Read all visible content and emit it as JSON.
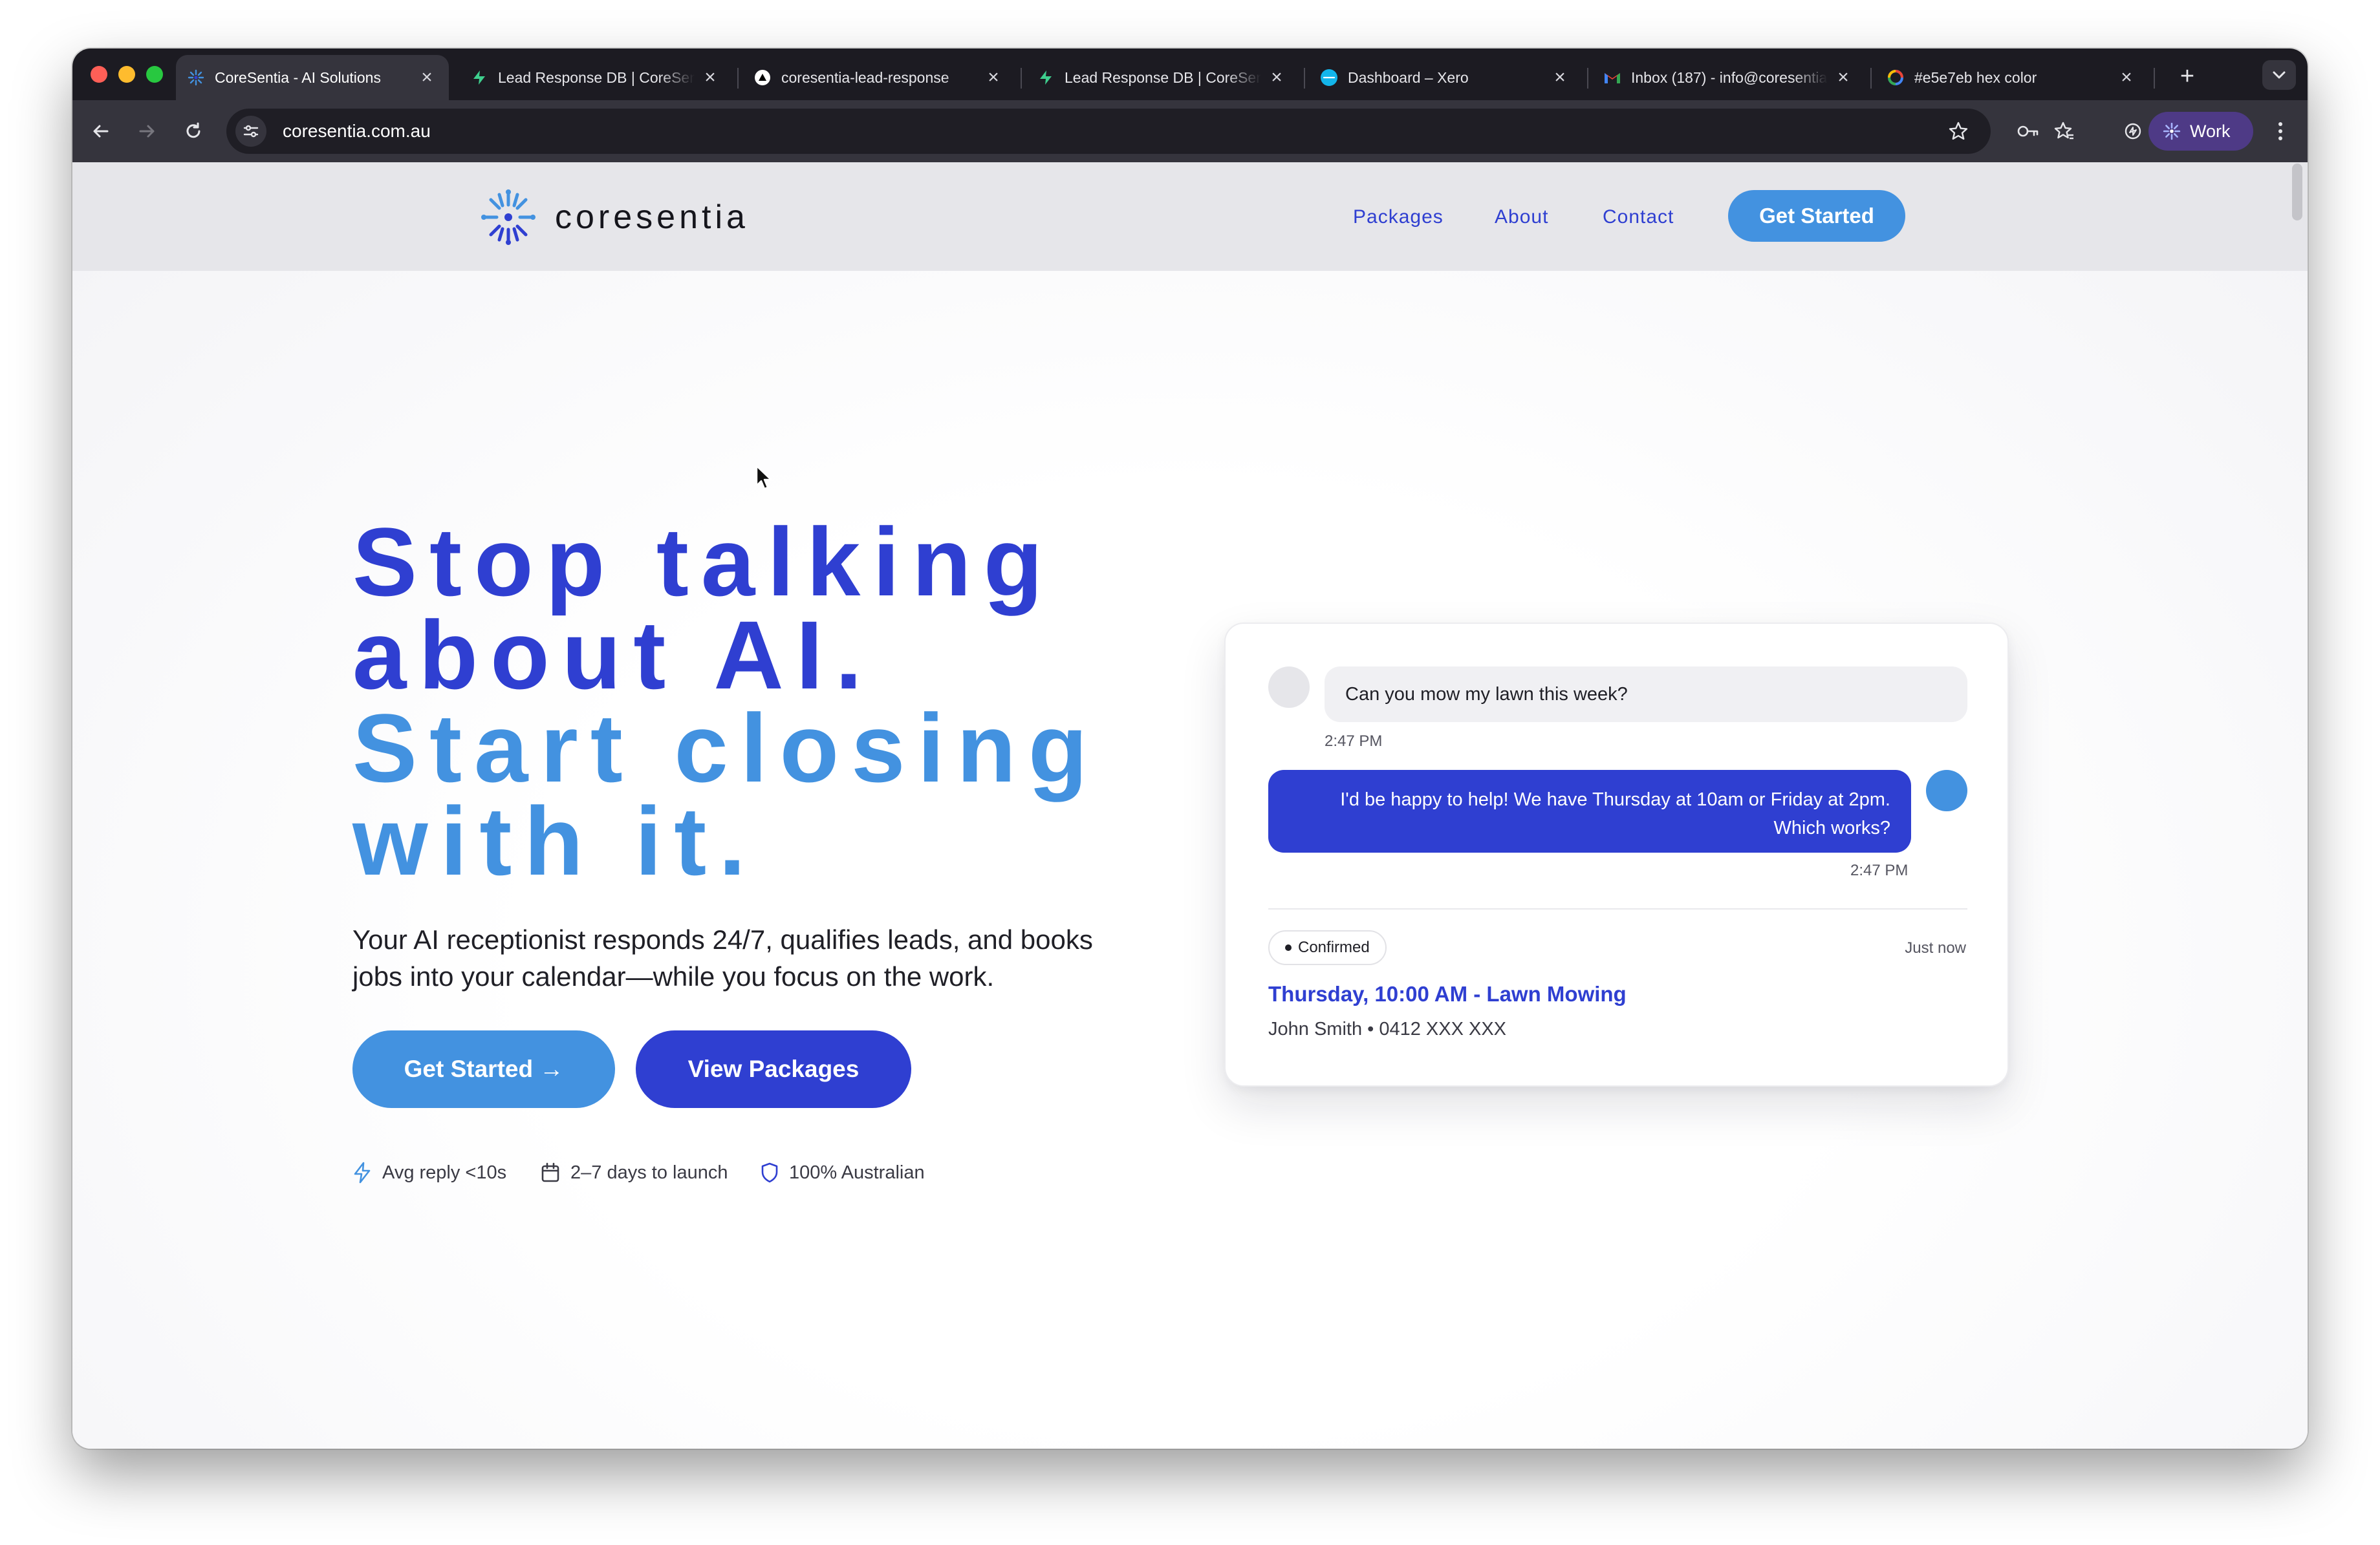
{
  "browser": {
    "tabs": [
      {
        "title": "CoreSentia - AI Solutions",
        "icon": "coresentia-favicon",
        "active": true
      },
      {
        "title": "Lead Response DB | CoreSentia",
        "icon": "supabase-favicon",
        "active": false
      },
      {
        "title": "coresentia-lead-response",
        "icon": "vercel-favicon",
        "active": false
      },
      {
        "title": "Lead Response DB | CoreSentia",
        "icon": "supabase-favicon",
        "active": false
      },
      {
        "title": "Dashboard – Xero",
        "icon": "xero-favicon",
        "active": false
      },
      {
        "title": "Inbox (187) - info@coresentia",
        "icon": "gmail-favicon",
        "active": false
      },
      {
        "title": "#e5e7eb hex color",
        "icon": "google-favicon",
        "active": false
      }
    ],
    "url": "coresentia.com.au",
    "profile_label": "Work"
  },
  "site": {
    "brand": "coresentia",
    "nav": {
      "packages": "Packages",
      "about": "About",
      "contact": "Contact",
      "cta": "Get Started"
    }
  },
  "hero": {
    "title_line1": "Stop talking",
    "title_line2": "about AI.",
    "title_line3": "Start closing",
    "title_line4": "with it.",
    "subtitle": "Your AI receptionist responds 24/7, qualifies leads, and books jobs into your calendar—while you focus on the work.",
    "primary_button": "Get Started →",
    "secondary_button": "View Packages",
    "features": [
      {
        "icon": "lightning-icon",
        "label": "Avg reply <10s"
      },
      {
        "icon": "calendar-icon",
        "label": "2–7 days to launch"
      },
      {
        "icon": "shield-icon",
        "label": "100% Australian"
      }
    ]
  },
  "chat_card": {
    "incoming_message": "Can you mow my lawn this week?",
    "incoming_time": "2:47 PM",
    "outgoing_message": "I'd be happy to help! We have Thursday at 10am or Friday at 2pm. Which works?",
    "outgoing_time": "2:47 PM",
    "status_label": "Confirmed",
    "status_time": "Just now",
    "booking_title": "Thursday, 10:00 AM - Lawn Mowing",
    "booking_detail": "John Smith • 0412 XXX XXX"
  },
  "colors": {
    "brand_blue": "#2f3fd1",
    "accent_blue": "#4392e0",
    "header_gray": "#e6e6ea",
    "browser_dark": "#1c1b22"
  }
}
